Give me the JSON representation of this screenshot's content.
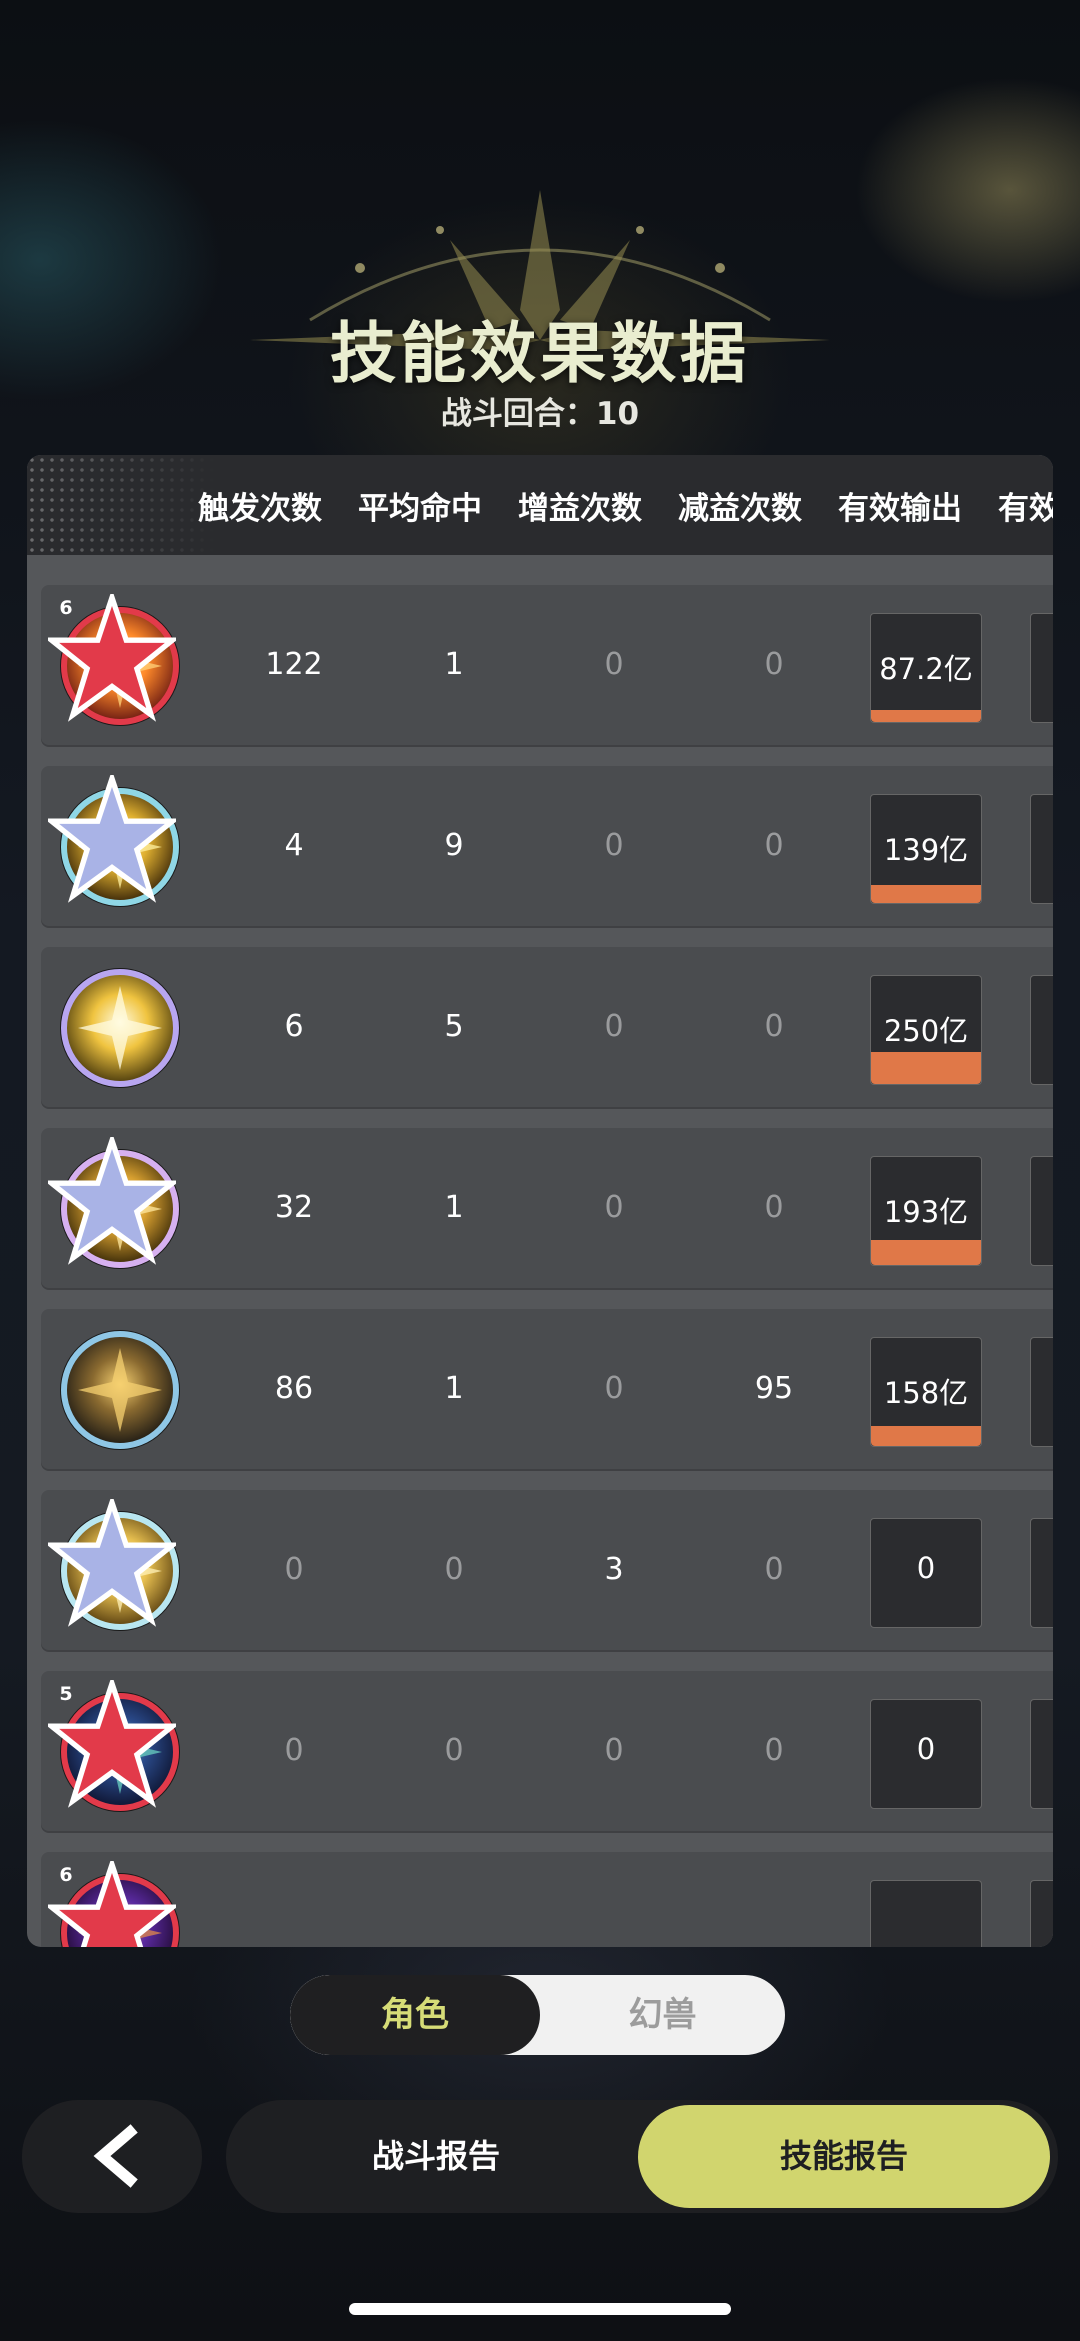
{
  "header": {
    "title": "技能效果数据",
    "subtitle": "战斗回合：10"
  },
  "columns": [
    "触发次数",
    "平均命中",
    "增益次数",
    "减益次数",
    "有效输出",
    "有效"
  ],
  "rows": [
    {
      "badge": "6",
      "badge_color": "#e23a4a",
      "ring": "#e23a4a",
      "icon": "fire-star-skill-icon",
      "trigger": "122",
      "avg_hit": "1",
      "buff": "0",
      "debuff": "0",
      "output": "87.2亿",
      "output_level": 0.12
    },
    {
      "badge": "",
      "badge_color": "#a9b3e6",
      "ring": "#8fd7e6",
      "icon": "lightning-burst-skill-icon",
      "trigger": "4",
      "avg_hit": "9",
      "buff": "0",
      "debuff": "0",
      "output": "139亿",
      "output_level": 0.18
    },
    {
      "badge": "",
      "badge_color": "",
      "ring": "#b8a6f0",
      "icon": "radiant-star-skill-icon",
      "trigger": "6",
      "avg_hit": "5",
      "buff": "0",
      "debuff": "0",
      "output": "250亿",
      "output_level": 0.32
    },
    {
      "badge": "",
      "badge_color": "#a9b3e6",
      "ring": "#d6b0f0",
      "icon": "golden-orb-skill-icon",
      "trigger": "32",
      "avg_hit": "1",
      "buff": "0",
      "debuff": "0",
      "output": "193亿",
      "output_level": 0.25
    },
    {
      "badge": "",
      "badge_color": "",
      "ring": "#8fc7e6",
      "icon": "golden-ring-skill-icon",
      "trigger": "86",
      "avg_hit": "1",
      "buff": "0",
      "debuff": "95",
      "output": "158亿",
      "output_level": 0.2
    },
    {
      "badge": "",
      "badge_color": "#a9b3e6",
      "ring": "#b8e6f0",
      "icon": "keyhole-shield-skill-icon",
      "trigger": "0",
      "avg_hit": "0",
      "buff": "3",
      "debuff": "0",
      "output": "0",
      "output_level": 0
    },
    {
      "badge": "5",
      "badge_color": "#e23a4a",
      "ring": "#e23a4a",
      "icon": "spirit-figure-skill-icon",
      "trigger": "0",
      "avg_hit": "0",
      "buff": "0",
      "debuff": "0",
      "output": "0",
      "output_level": 0
    },
    {
      "badge": "6",
      "badge_color": "#e23a4a",
      "ring": "#e23a4a",
      "icon": "violet-flame-skill-icon",
      "trigger": "",
      "avg_hit": "",
      "buff": "",
      "debuff": "",
      "output": "",
      "output_level": 0
    }
  ],
  "toggle": {
    "active": "角色",
    "other": "幻兽"
  },
  "footer": {
    "back_icon": "chevron-left-icon",
    "battle_report": "战斗报告",
    "skill_report": "技能报告"
  },
  "colors": {
    "accent": "#d1d56e",
    "output_bar": "#e07848",
    "title": "#e9edcf"
  }
}
